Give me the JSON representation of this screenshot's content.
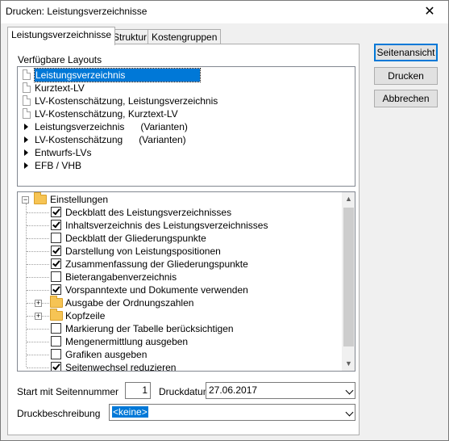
{
  "window": {
    "title": "Drucken: Leistungsverzeichnisse",
    "close_glyph": "✕"
  },
  "tabs": [
    "Leistungsverzeichnisse",
    "Struktur",
    "Kostengruppen"
  ],
  "layouts": {
    "label": "Verfügbare Layouts",
    "items": [
      {
        "text": "Leistungsverzeichnis",
        "icon": "document-icon",
        "selected": true
      },
      {
        "text": "Kurztext-LV",
        "icon": "document-icon"
      },
      {
        "text": "LV-Kostenschätzung, Leistungsverzeichnis",
        "icon": "document-icon"
      },
      {
        "text": "LV-Kostenschätzung, Kurztext-LV",
        "icon": "document-icon"
      },
      {
        "text": "Leistungsverzeichnis      (Varianten)",
        "icon": "expand-triangle-icon"
      },
      {
        "text": "LV-Kostenschätzung      (Varianten)",
        "icon": "expand-triangle-icon"
      },
      {
        "text": "Entwurfs-LVs",
        "icon": "expand-triangle-icon"
      },
      {
        "text": "EFB / VHB",
        "icon": "expand-triangle-icon"
      }
    ]
  },
  "settings": {
    "root": {
      "text": "Einstellungen",
      "expander": "⊟"
    },
    "items": [
      {
        "text": "Deckblatt des Leistungsverzeichnisses",
        "checked": true
      },
      {
        "text": "Inhaltsverzeichnis des Leistungsverzeichnisses",
        "checked": true
      },
      {
        "text": "Deckblatt der Gliederungspunkte",
        "checked": false
      },
      {
        "text": "Darstellung von Leistungspositionen",
        "checked": true
      },
      {
        "text": "Zusammenfassung der Gliederungspunkte",
        "checked": true
      },
      {
        "text": "Bieterangabenverzeichnis",
        "checked": false
      },
      {
        "text": "Vorspanntexte und Dokumente verwenden",
        "checked": true
      },
      {
        "text": "Ausgabe der Ordnungszahlen",
        "folder": true,
        "expander": "+"
      },
      {
        "text": "Kopfzeile",
        "folder": true,
        "expander": "+"
      },
      {
        "text": "Markierung der Tabelle berücksichtigen",
        "checked": false
      },
      {
        "text": "Mengenermittlung ausgeben",
        "checked": false
      },
      {
        "text": "Grafiken ausgeben",
        "checked": false
      },
      {
        "text": "Seitenwechsel reduzieren",
        "checked": true
      }
    ]
  },
  "form": {
    "start_label": "Start mit Seitennummer",
    "start_value": "1",
    "date_label": "Druckdatum",
    "date_value": "27.06.2017",
    "desc_label": "Druckbeschreibung",
    "desc_value": "<keine>"
  },
  "buttons": {
    "preview": "Seitenansicht",
    "print": "Drucken",
    "cancel": "Abbrechen"
  },
  "colors": {
    "selection": "#0078d7",
    "folder": "#f6c454"
  }
}
